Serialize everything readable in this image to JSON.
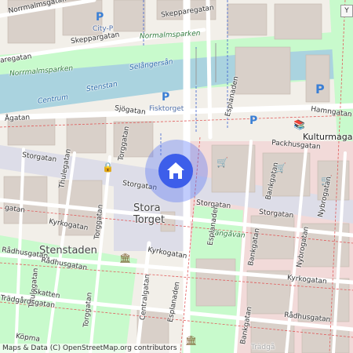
{
  "map": {
    "center_label": "home-marker",
    "attribution": "Maps & Data (C) OpenStreetMap.org contributors",
    "corner_button": "Y"
  },
  "labels": {
    "normalmsgatan": "Norrmalmsgatan",
    "skepparegatan_top": "Skepparegatan",
    "skeppargatan_left": "Skeppargatan",
    "city_p": "City-P",
    "normalmsparken_top": "Normalmsparken",
    "aregatan": "aregatan",
    "selangersan": "Selångersån",
    "normalmsparken_left": "Norrmalmsparken",
    "stenstan": "Stenstan",
    "centrum": "Centrum",
    "fisktorget": "Fisktorget",
    "esplanaden_top": "Esplanaden",
    "hamngatan": "Hamngatan",
    "agatan": "Ågatan",
    "sjogatan": "Sjögatan",
    "torggatan_top": "Torggatan",
    "kulturmagasinet": "Kulturmagasinet",
    "packhusgatan": "Packhusgatan",
    "storgatan_left": "Storgatan",
    "thulegatan_top": "Thulegatan",
    "storgatan_mid": "Storgatan",
    "storgatan_right": "Storgatan",
    "bankgatan_top": "Bankgatan",
    "nybrogatan_top": "Nybrogatan",
    "stora_torget": "Stora\nTorget",
    "vangavan": "Vängåvan",
    "esplanaden_mid": "Esplanaden",
    "bankgatan_mid": "Bankgatan",
    "nybrogatan_mid": "Nybrogatan",
    "storgatan_far": "Storgatan",
    "gatan_left": "gatan",
    "kyrkogatan_left": "Kyrkogatan",
    "kyrkogatan_mid": "Kyrkogatan",
    "kyrkogatan_right": "Kyrkogatan",
    "stenstaden": "Stenstaden",
    "radhusgatan_left": "Rådhusgatan",
    "radhusgatan_right": "Rådhusgatan",
    "torggatan_mid": "Torggatan",
    "thulegatan_mid": "Thulegatan",
    "centralgatan": "Centralgatan",
    "esplanaden_bottom": "Esplanaden",
    "skatten": "Skatten",
    "tradgardsgatan": "Trädgårdsgatan",
    "torggatan_bottom": "Torggatan",
    "bankgatan_bottom": "Bankgatan",
    "kopman": "Köpma",
    "tradgarden": "Trädgå"
  },
  "colors": {
    "water": "#aad3df",
    "park": "#c8facc",
    "building": "#d9d0c9",
    "pedestrian": "#dddde8",
    "road_major": "#ffffff",
    "road_outline": "#c9c3b9",
    "marker": "#3d5eea",
    "marker_halo": "#4c6ef5",
    "commercial": "#f2dad9"
  },
  "icons": {
    "home": "home-icon",
    "parking": "parking-icon",
    "shop": "shop-icon",
    "museum": "museum-icon",
    "townhall": "townhall-icon"
  }
}
